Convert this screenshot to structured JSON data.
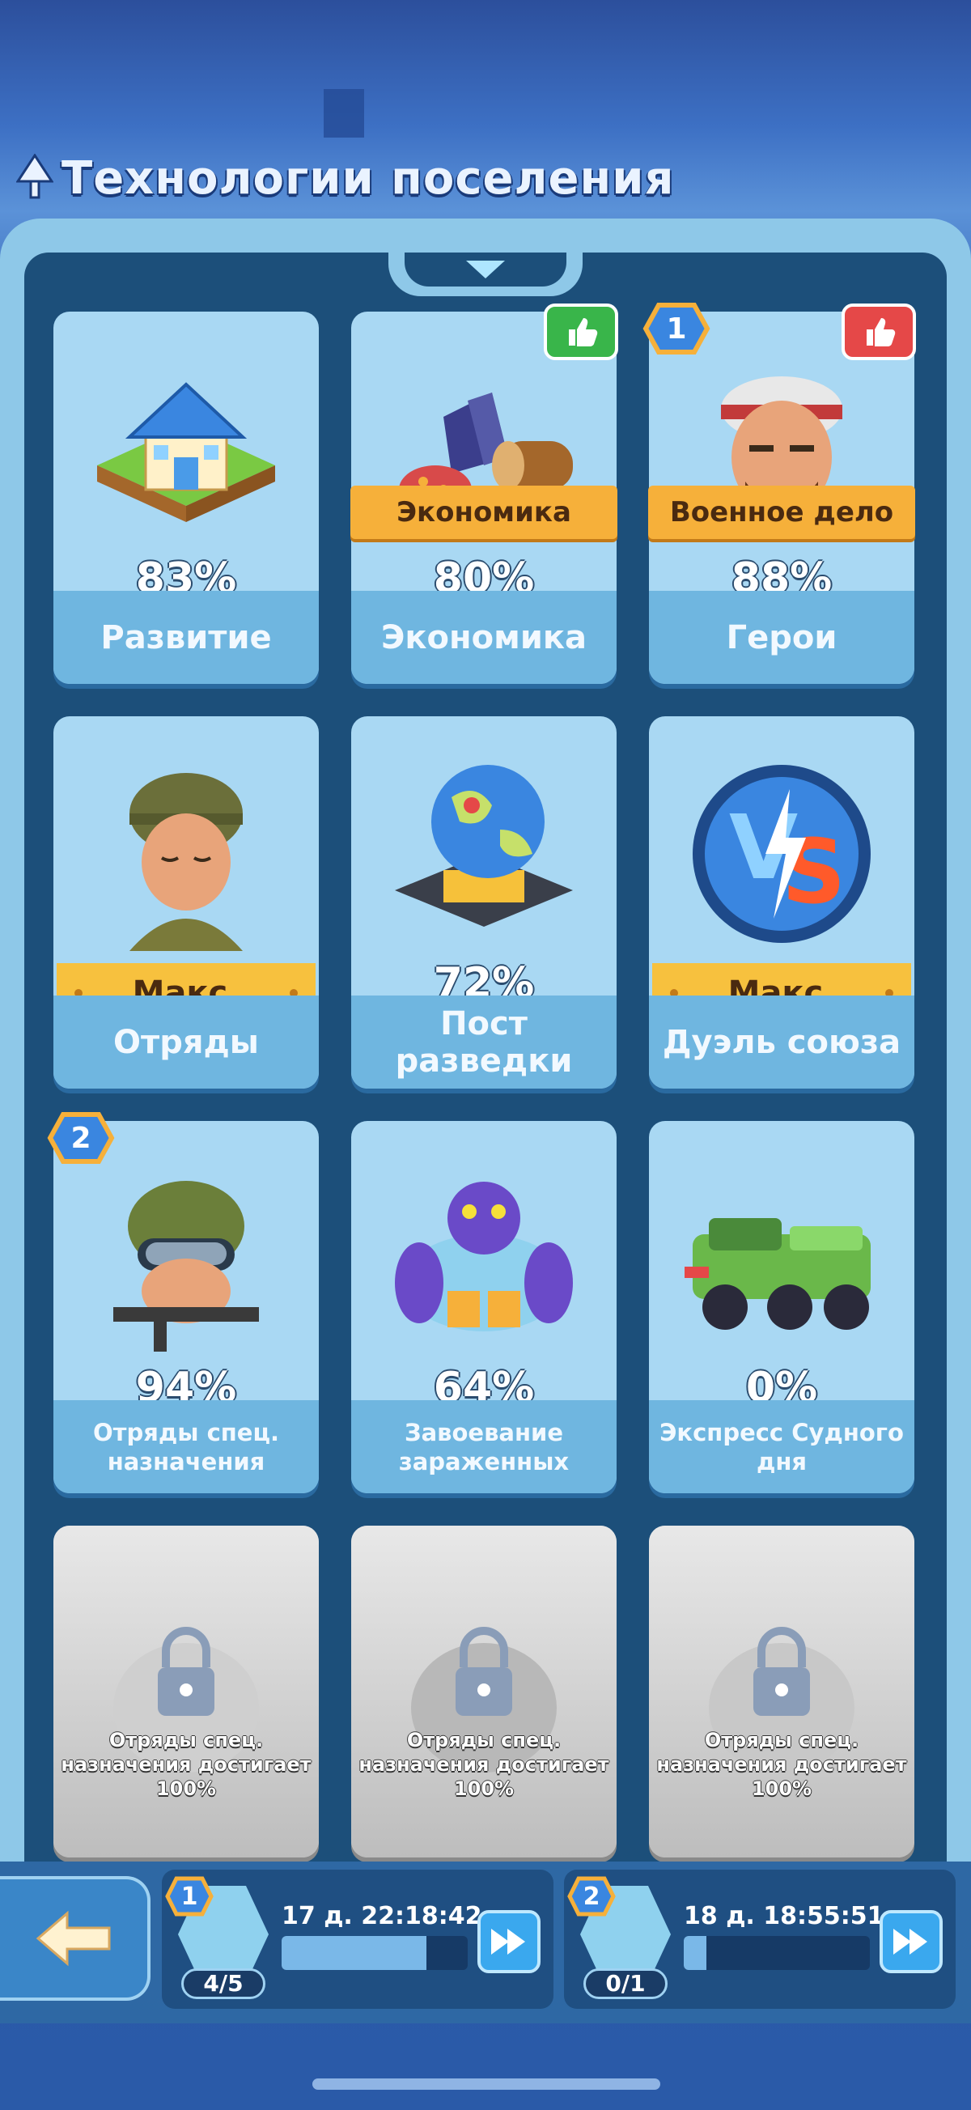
{
  "header": {
    "title": "Технологии поселения",
    "icon": "tree-icon"
  },
  "cards": [
    {
      "name": "Развитие",
      "percent": "83%",
      "icon": "house-icon"
    },
    {
      "name": "Экономика",
      "percent": "80%",
      "ribbon": "Экономика",
      "icon": "resources-icon",
      "thumb": "green"
    },
    {
      "name": "Герои",
      "percent": "88%",
      "ribbon": "Военное дело",
      "icon": "hero-icon",
      "badge": "1",
      "thumb": "red"
    },
    {
      "name": "Отряды",
      "status": "Макс.",
      "icon": "soldier-icon"
    },
    {
      "name": "Пост разведки",
      "percent": "72%",
      "icon": "globe-icon"
    },
    {
      "name": "Дуэль союза",
      "status": "Макс.",
      "icon": "vs-icon"
    },
    {
      "name": "Отряды спец. назначения",
      "percent": "94%",
      "icon": "special-forces-icon",
      "badge": "2"
    },
    {
      "name": "Завоевание зараженных",
      "percent": "64%",
      "icon": "zombie-icon"
    },
    {
      "name": "Экспресс Судного дня",
      "percent": "0%",
      "icon": "truck-icon"
    }
  ],
  "locked": [
    {
      "text": "Отряды спец. назначения достигает 100%"
    },
    {
      "text": "Отряды спец. назначения достигает 100%"
    },
    {
      "text": "Отряды спец. назначения достигает 100%"
    }
  ],
  "queues": [
    {
      "badge": "1",
      "timer": "17 д. 22:18:42",
      "count": "4/5",
      "progress": 0.78
    },
    {
      "badge": "2",
      "timer": "18 д. 18:55:51",
      "count": "0/1",
      "progress": 0.12
    }
  ],
  "colors": {
    "accent": "#f6b03a",
    "card": "#a9d8f3",
    "panel": "#1c4f7a",
    "thumb_green": "#39b54a",
    "thumb_red": "#e54848"
  }
}
